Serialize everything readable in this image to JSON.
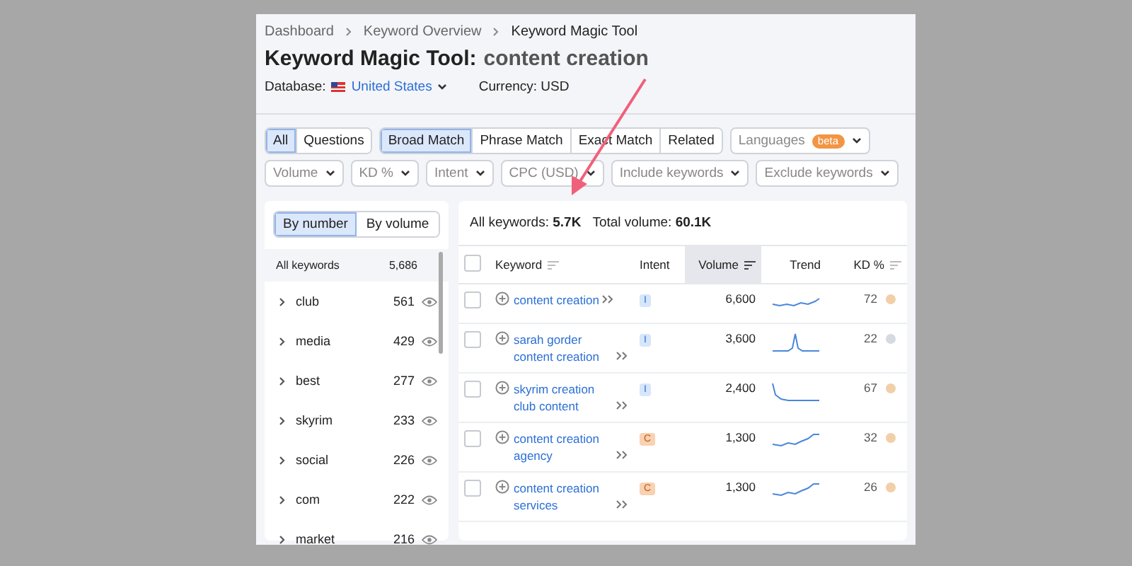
{
  "breadcrumb": [
    {
      "label": "Dashboard",
      "current": false
    },
    {
      "label": "Keyword Overview",
      "current": false
    },
    {
      "label": "Keyword Magic Tool",
      "current": true
    }
  ],
  "title": {
    "label": "Keyword Magic Tool:",
    "query": "content creation"
  },
  "database": {
    "label": "Database:",
    "value": "United States"
  },
  "currency": "Currency: USD",
  "filter_groups": [
    [
      {
        "label": "All",
        "selected": true
      },
      {
        "label": "Questions",
        "selected": false
      }
    ],
    [
      {
        "label": "Broad Match",
        "selected": true
      },
      {
        "label": "Phrase Match",
        "selected": false
      },
      {
        "label": "Exact Match",
        "selected": false
      },
      {
        "label": "Related",
        "selected": false
      }
    ]
  ],
  "languages": {
    "label": "Languages",
    "badge": "beta"
  },
  "dropdowns": [
    "Volume",
    "KD %",
    "Intent",
    "CPC (USD)",
    "Include keywords",
    "Exclude keywords"
  ],
  "sort_toggle": [
    {
      "label": "By number",
      "selected": true
    },
    {
      "label": "By volume",
      "selected": false
    }
  ],
  "groups_total": {
    "label": "All keywords",
    "count": "5,686"
  },
  "groups": [
    {
      "label": "club",
      "count": "561"
    },
    {
      "label": "media",
      "count": "429"
    },
    {
      "label": "best",
      "count": "277"
    },
    {
      "label": "skyrim",
      "count": "233"
    },
    {
      "label": "social",
      "count": "226"
    },
    {
      "label": "com",
      "count": "222"
    },
    {
      "label": "market",
      "count": "216"
    }
  ],
  "summary": {
    "keywords_label": "All keywords:",
    "keywords": "5.7K",
    "volume_label": "Total volume:",
    "volume": "60.1K"
  },
  "table": {
    "header_checked": false,
    "columns": [
      {
        "label": "Keyword",
        "sortable": true,
        "sorted": false
      },
      {
        "label": "Intent",
        "sortable": false,
        "sorted": false
      },
      {
        "label": "Volume",
        "sortable": true,
        "sorted": true
      },
      {
        "label": "Trend",
        "sortable": false,
        "sorted": false
      },
      {
        "label": "KD %",
        "sortable": true,
        "sorted": false
      }
    ],
    "rows": [
      {
        "checked": false,
        "keyword": "content creation",
        "intent": {
          "letter": "I",
          "kind": "informational"
        },
        "volume": "6,600",
        "trend": {
          "kind": "flat"
        },
        "kd": "72",
        "color": "#f1cfa8"
      },
      {
        "checked": false,
        "keyword": "sarah gorder content creation",
        "intent": {
          "letter": "I",
          "kind": "informational"
        },
        "volume": "3,600",
        "trend": {
          "kind": "spike"
        },
        "kd": "22",
        "color": "#d5d9e0"
      },
      {
        "checked": false,
        "keyword": "skyrim creation club content",
        "intent": {
          "letter": "I",
          "kind": "informational"
        },
        "volume": "2,400",
        "trend": {
          "kind": "decline"
        },
        "kd": "67",
        "color": "#f1cfa8"
      },
      {
        "checked": false,
        "keyword": "content creation agency",
        "intent": {
          "letter": "C",
          "kind": "commercial"
        },
        "volume": "1,300",
        "trend": {
          "kind": "rise"
        },
        "kd": "32",
        "color": "#f1cfa8"
      },
      {
        "checked": false,
        "keyword": "content creation services",
        "intent": {
          "letter": "C",
          "kind": "commercial"
        },
        "volume": "1,300",
        "trend": {
          "kind": "rise"
        },
        "kd": "26",
        "color": "#f1cfa8"
      }
    ]
  }
}
